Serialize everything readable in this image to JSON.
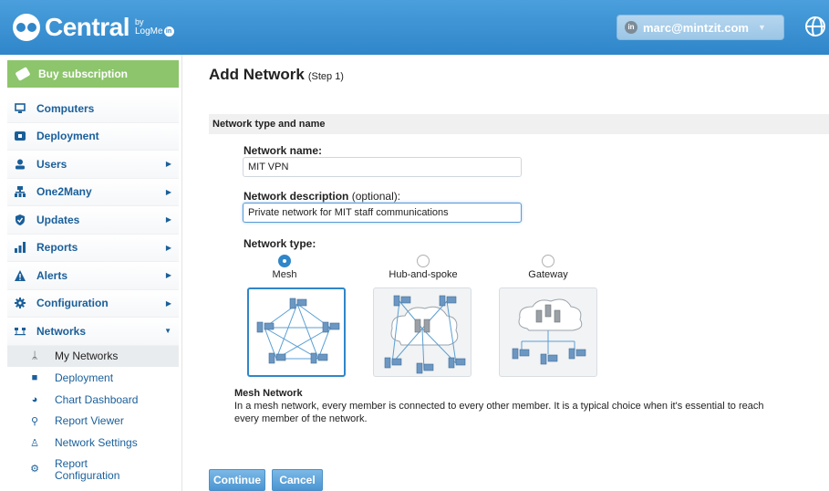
{
  "header": {
    "logo_text": "Central",
    "logo_by": "by",
    "logo_brand": "LogMe",
    "logo_brand_in": "in",
    "account_email": "marc@mintzit.com"
  },
  "sidebar": {
    "buy_label": "Buy subscription",
    "items": [
      {
        "label": "Computers",
        "icon": "monitor-icon",
        "has_arrow": false
      },
      {
        "label": "Deployment",
        "icon": "deploy-icon",
        "has_arrow": false
      },
      {
        "label": "Users",
        "icon": "user-icon",
        "has_arrow": true
      },
      {
        "label": "One2Many",
        "icon": "hierarchy-icon",
        "has_arrow": true
      },
      {
        "label": "Updates",
        "icon": "shield-icon",
        "has_arrow": true
      },
      {
        "label": "Reports",
        "icon": "bar-chart-icon",
        "has_arrow": true
      },
      {
        "label": "Alerts",
        "icon": "warning-icon",
        "has_arrow": true
      },
      {
        "label": "Configuration",
        "icon": "gear-icon",
        "has_arrow": true
      },
      {
        "label": "Networks",
        "icon": "network-icon",
        "has_arrow": true,
        "expanded": true
      }
    ],
    "network_sub": [
      {
        "label": "My Networks",
        "icon": "hierarchy-icon",
        "active": true
      },
      {
        "label": "Deployment",
        "icon": "deploy-icon"
      },
      {
        "label": "Chart Dashboard",
        "icon": "pie-chart-icon"
      },
      {
        "label": "Report Viewer",
        "icon": "report-viewer-icon"
      },
      {
        "label": "Network Settings",
        "icon": "settings-user-icon"
      },
      {
        "label": "Report Configuration",
        "icon": "report-config-icon"
      }
    ]
  },
  "main": {
    "title": "Add Network",
    "step": "(Step 1)",
    "section_title": "Network type and name",
    "name_label": "Network name:",
    "name_value": "MIT VPN",
    "desc_label": "Network description",
    "desc_optional": "(optional):",
    "desc_value": "Private network for MIT staff communications",
    "type_label": "Network type:",
    "types": [
      {
        "label": "Mesh",
        "selected": true
      },
      {
        "label": "Hub-and-spoke",
        "selected": false
      },
      {
        "label": "Gateway",
        "selected": false
      }
    ],
    "selected_title": "Mesh Network",
    "selected_desc": "In a mesh network, every member is connected to every other member. It is a typical choice when it's essential to reach every member of the network.",
    "continue_label": "Continue",
    "cancel_label": "Cancel"
  },
  "colors": {
    "header_blue": "#2f86c9",
    "buy_green": "#8cc56b",
    "nav_text": "#1a5f9a"
  }
}
